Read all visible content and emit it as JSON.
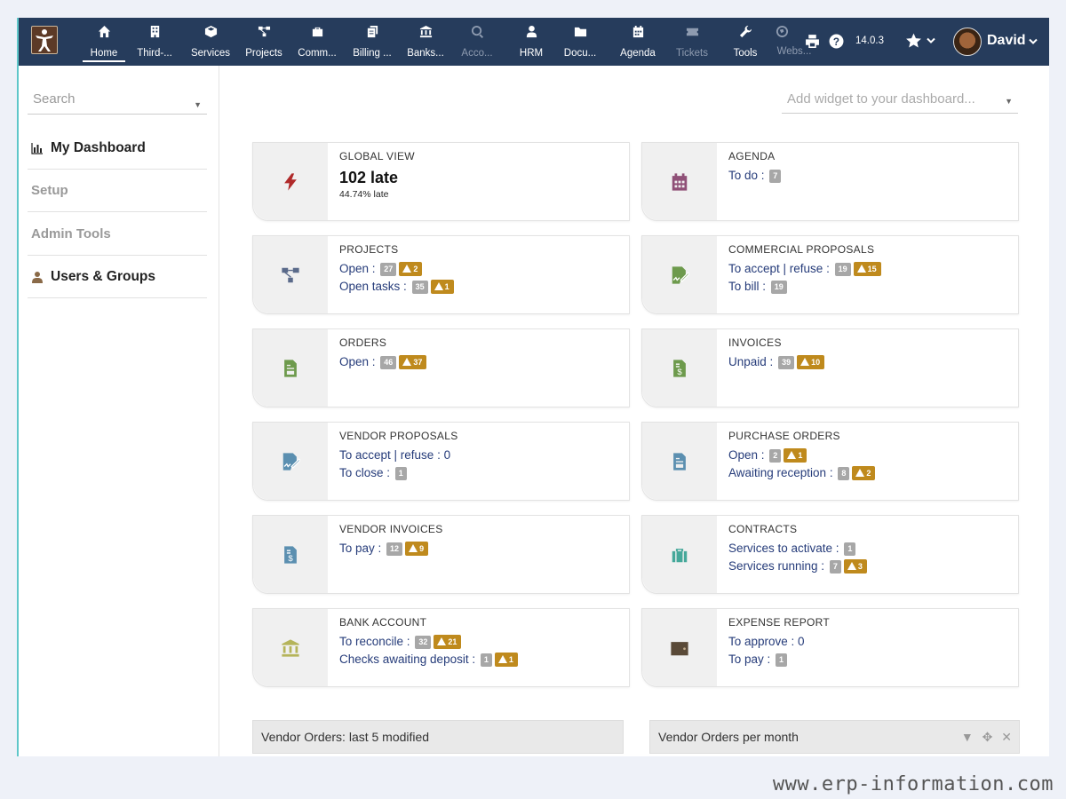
{
  "topbar": {
    "menu": [
      {
        "label": "Home",
        "icon": "home-icon"
      },
      {
        "label": "Third-...",
        "icon": "building-icon"
      },
      {
        "label": "Services",
        "icon": "cube-icon"
      },
      {
        "label": "Projects",
        "icon": "sitemap-icon"
      },
      {
        "label": "Comm...",
        "icon": "suitcase-icon"
      },
      {
        "label": "Billing ...",
        "icon": "invoices-icon"
      },
      {
        "label": "Banks...",
        "icon": "bank-icon"
      },
      {
        "label": "Acco...",
        "icon": "search-dollar-icon"
      },
      {
        "label": "HRM",
        "icon": "user-tie-icon"
      },
      {
        "label": "Docu...",
        "icon": "folder-icon"
      },
      {
        "label": "Agenda",
        "icon": "calendar-icon"
      },
      {
        "label": "Tickets",
        "icon": "ticket-icon"
      },
      {
        "label": "Tools",
        "icon": "wrench-icon"
      },
      {
        "label": "Webs...",
        "icon": "globe-icon"
      }
    ],
    "version": "14.0.3",
    "username": "David"
  },
  "sidebar": {
    "search_placeholder": "Search",
    "items": [
      {
        "label": "My Dashboard"
      },
      {
        "label": "Setup"
      },
      {
        "label": "Admin Tools"
      },
      {
        "label": "Users & Groups"
      }
    ]
  },
  "main": {
    "widget_placeholder": "Add widget to your dashboard...",
    "cards": {
      "global": {
        "title": "GLOBAL VIEW",
        "big": "102 late",
        "small": "44.74% late"
      },
      "agenda": {
        "title": "AGENDA",
        "l1": "To do :",
        "b1": "7"
      },
      "projects": {
        "title": "PROJECTS",
        "l1": "Open :",
        "b1": "27",
        "w1": "2",
        "l2": "Open tasks :",
        "b2": "35",
        "w2": "1"
      },
      "commercial": {
        "title": "COMMERCIAL PROPOSALS",
        "l1": "To accept | refuse :",
        "b1": "19",
        "w1": "15",
        "l2": "To bill :",
        "b2": "19"
      },
      "orders": {
        "title": "ORDERS",
        "l1": "Open :",
        "b1": "46",
        "w1": "37"
      },
      "invoices": {
        "title": "INVOICES",
        "l1": "Unpaid :",
        "b1": "39",
        "w1": "10"
      },
      "vendor_proposals": {
        "title": "VENDOR PROPOSALS",
        "l1": "To accept | refuse : 0",
        "l2": "To close :",
        "b2": "1"
      },
      "purchase_orders": {
        "title": "PURCHASE ORDERS",
        "l1": "Open :",
        "b1": "2",
        "w1": "1",
        "l2": "Awaiting reception :",
        "b2": "8",
        "w2": "2"
      },
      "vendor_invoices": {
        "title": "VENDOR INVOICES",
        "l1": "To pay :",
        "b1": "12",
        "w1": "9"
      },
      "contracts": {
        "title": "CONTRACTS",
        "l1": "Services to activate :",
        "b1": "1",
        "l2": "Services running :",
        "b2": "7",
        "w2": "3"
      },
      "bank": {
        "title": "BANK ACCOUNT",
        "l1": "To reconcile :",
        "b1": "32",
        "w1": "21",
        "l2": "Checks awaiting deposit :",
        "b2": "1",
        "w2": "1"
      },
      "expense": {
        "title": "EXPENSE REPORT",
        "l1": "To approve : 0",
        "l2": "To pay :",
        "b2": "1"
      }
    },
    "panels": [
      {
        "title": "Vendor Orders: last 5 modified"
      },
      {
        "title": "Vendor Orders per month"
      }
    ]
  },
  "watermark": "www.erp-information.com",
  "colors": {
    "topbar": "#263c5c",
    "warning": "#bf8a1d",
    "badge": "#a7a7a7",
    "accent_border": "#5fc7c9"
  }
}
